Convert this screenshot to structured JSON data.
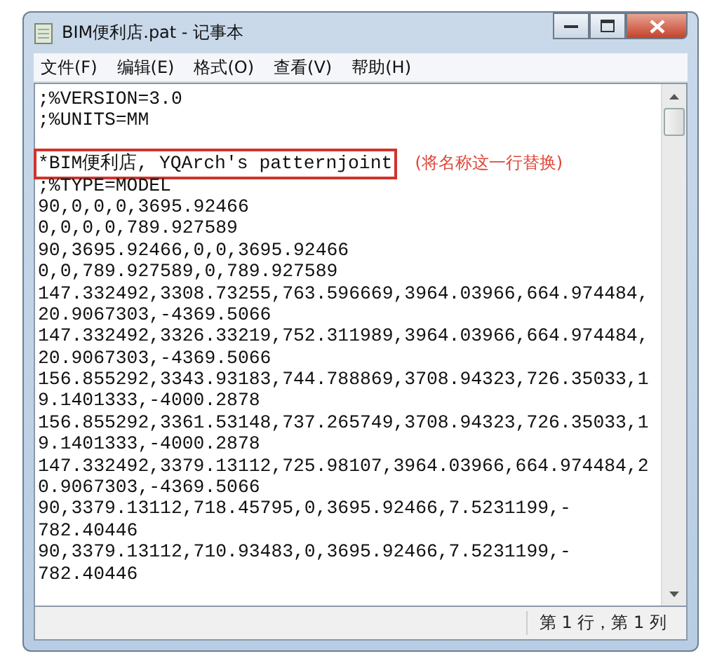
{
  "window": {
    "title": "BIM便利店.pat - 记事本"
  },
  "menu": [
    {
      "label": "文件(F)"
    },
    {
      "label": "编辑(E)"
    },
    {
      "label": "格式(O)"
    },
    {
      "label": "查看(V)"
    },
    {
      "label": "帮助(H)"
    }
  ],
  "lines": [
    {
      "kind": "text",
      "text": ";%VERSION=3.0",
      "boxed": false
    },
    {
      "kind": "text",
      "text": ";%UNITS=MM",
      "boxed": false
    },
    {
      "kind": "blank"
    },
    {
      "kind": "text",
      "text": "*BIM便利店, YQArch's patternjoint",
      "boxed": true,
      "note": "(将名称这一行替换)"
    },
    {
      "kind": "text",
      "text": ";%TYPE=MODEL",
      "boxed": false
    },
    {
      "kind": "text",
      "text": "90,0,0,0,3695.92466",
      "boxed": false
    },
    {
      "kind": "text",
      "text": "0,0,0,0,789.927589",
      "boxed": false
    },
    {
      "kind": "text",
      "text": "90,3695.92466,0,0,3695.92466",
      "boxed": false
    },
    {
      "kind": "text",
      "text": "0,0,789.927589,0,789.927589",
      "boxed": false
    },
    {
      "kind": "text",
      "text": "147.332492,3308.73255,763.596669,3964.03966,664.974484,",
      "boxed": false
    },
    {
      "kind": "text",
      "text": "20.9067303,-4369.5066",
      "boxed": false
    },
    {
      "kind": "text",
      "text": "147.332492,3326.33219,752.311989,3964.03966,664.974484,",
      "boxed": false
    },
    {
      "kind": "text",
      "text": "20.9067303,-4369.5066",
      "boxed": false
    },
    {
      "kind": "text",
      "text": "156.855292,3343.93183,744.788869,3708.94323,726.35033,1",
      "boxed": false
    },
    {
      "kind": "text",
      "text": "9.1401333,-4000.2878",
      "boxed": false
    },
    {
      "kind": "text",
      "text": "156.855292,3361.53148,737.265749,3708.94323,726.35033,1",
      "boxed": false
    },
    {
      "kind": "text",
      "text": "9.1401333,-4000.2878",
      "boxed": false
    },
    {
      "kind": "text",
      "text": "147.332492,3379.13112,725.98107,3964.03966,664.974484,2",
      "boxed": false
    },
    {
      "kind": "text",
      "text": "0.9067303,-4369.5066",
      "boxed": false
    },
    {
      "kind": "text",
      "text": "90,3379.13112,718.45795,0,3695.92466,7.5231199,-",
      "boxed": false
    },
    {
      "kind": "text",
      "text": "782.40446",
      "boxed": false
    },
    {
      "kind": "text",
      "text": "90,3379.13112,710.93483,0,3695.92466,7.5231199,-",
      "boxed": false
    },
    {
      "kind": "text",
      "text": "782.40446",
      "boxed": false
    }
  ],
  "status_bar": {
    "position": "第 1 行，第 1 列"
  }
}
